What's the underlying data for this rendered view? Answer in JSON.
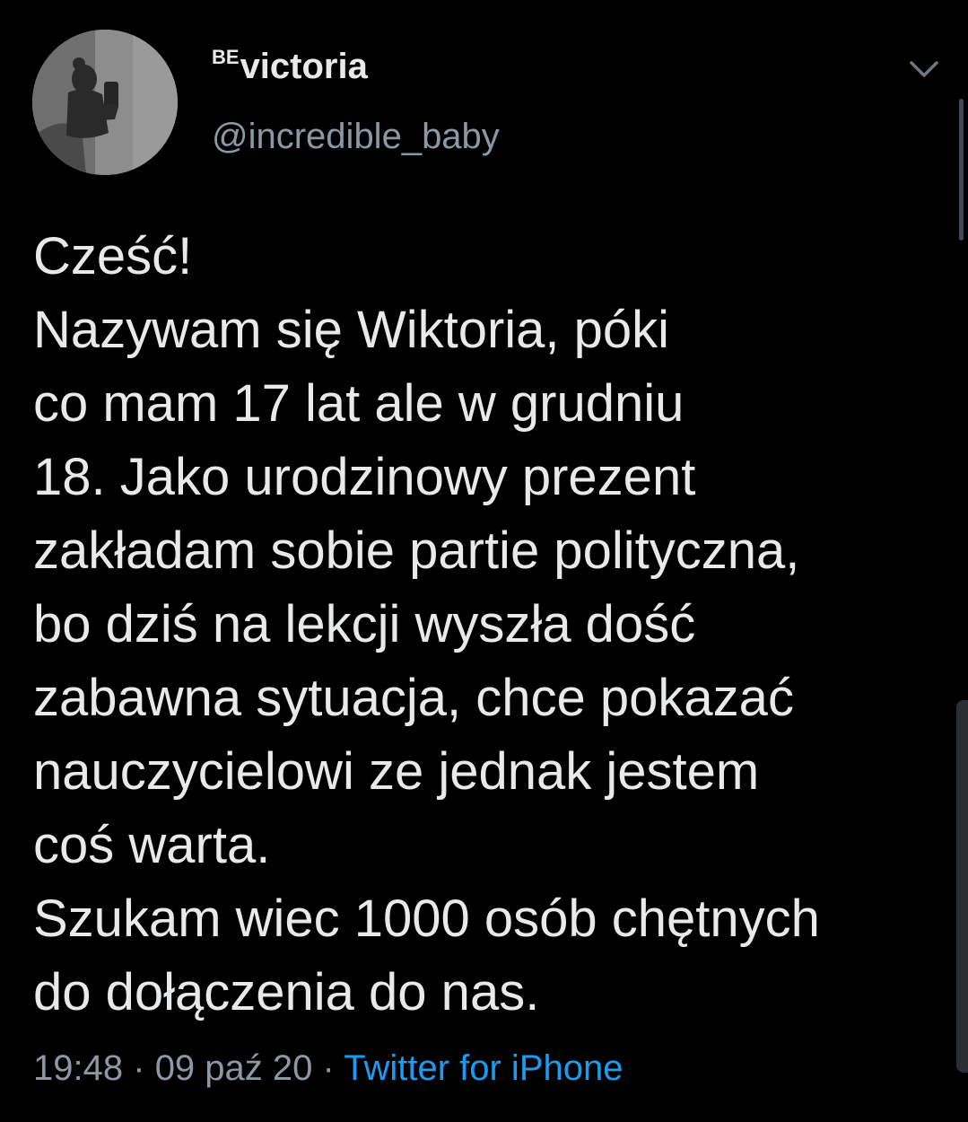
{
  "author": {
    "name_prefix": "BE",
    "name": "victoria",
    "handle": "@incredible_baby",
    "avatar_icon": "profile-silhouette-avatar"
  },
  "tweet": {
    "lines": [
      "Cześć!",
      "Nazywam się Wiktoria, póki",
      "co mam 17 lat ale w grudniu",
      "18. Jako urodzinowy prezent",
      "zakładam sobie partie polityczna,",
      "bo dziś na lekcji wyszła dość",
      "zabawna sytuacja, chce pokazać",
      "nauczycielowi ze jednak jestem",
      "coś warta.",
      "Szukam wiec 1000 osób chętnych",
      "do dołączenia do nas."
    ]
  },
  "meta": {
    "time": "19:48",
    "separator": "·",
    "date": "09 paź 20",
    "source": "Twitter for iPhone"
  },
  "icons": {
    "menu": "chevron-down-icon"
  },
  "colors": {
    "background": "#000000",
    "text": "#e7e9ea",
    "secondary": "#8b98a5",
    "link": "#1d9bf0"
  }
}
